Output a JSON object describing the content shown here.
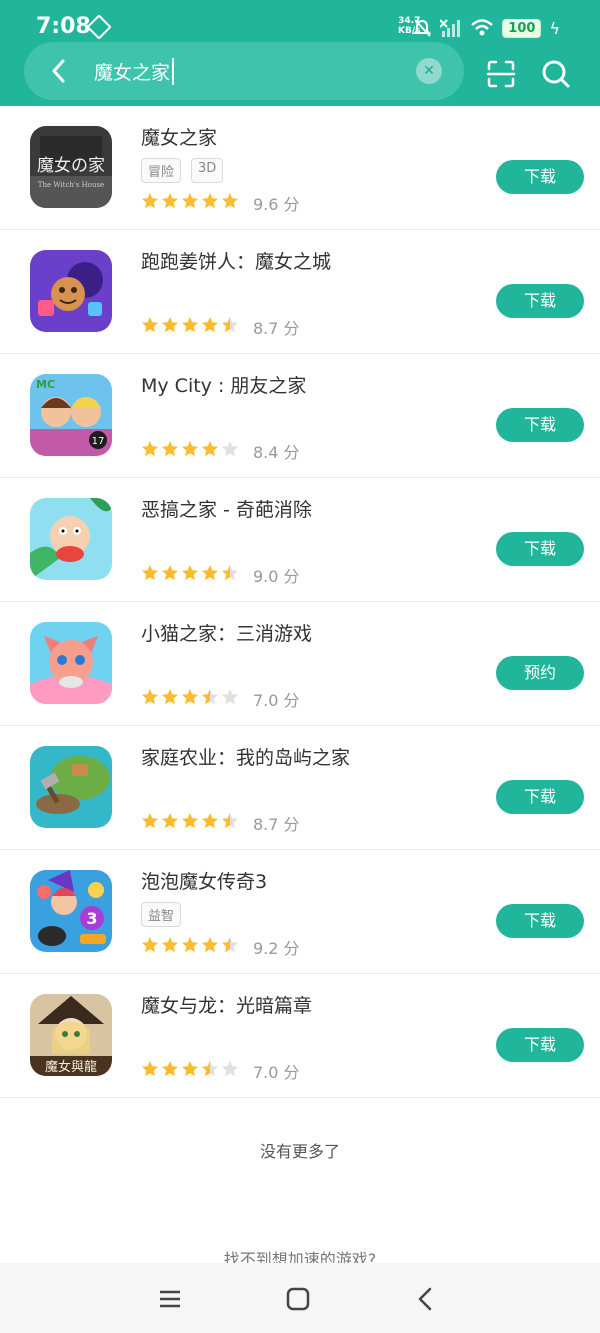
{
  "status_bar": {
    "time": "7:08",
    "net_speed_value": "34.7",
    "net_speed_unit": "KB/s",
    "battery": "100"
  },
  "search": {
    "query": "魔女之家"
  },
  "colors": {
    "accent": "#21b59c",
    "star": "#fdbb2d",
    "star_empty": "#e0e0e0"
  },
  "apps": [
    {
      "name": "魔女之家",
      "tags": [
        "冒险",
        "3D"
      ],
      "rating": 5.0,
      "score": "9.6 分",
      "button": "下载"
    },
    {
      "name": "跑跑姜饼人：魔女之城",
      "tags": [],
      "rating": 4.5,
      "score": "8.7 分",
      "button": "下载"
    },
    {
      "name": "My City : 朋友之家",
      "tags": [],
      "rating": 4.0,
      "score": "8.4 分",
      "button": "下载"
    },
    {
      "name": "恶搞之家 - 奇葩消除",
      "tags": [],
      "rating": 4.5,
      "score": "9.0 分",
      "button": "下载"
    },
    {
      "name": "小猫之家：三消游戏",
      "tags": [],
      "rating": 3.5,
      "score": "7.0 分",
      "button": "预约"
    },
    {
      "name": "家庭农业：我的岛屿之家",
      "tags": [],
      "rating": 4.5,
      "score": "8.7 分",
      "button": "下载"
    },
    {
      "name": "泡泡魔女传奇3",
      "tags": [
        "益智"
      ],
      "rating": 4.5,
      "score": "9.2 分",
      "button": "下载"
    },
    {
      "name": "魔女与龙：光暗篇章",
      "tags": [],
      "rating": 3.5,
      "score": "7.0 分",
      "button": "下载"
    }
  ],
  "footer": {
    "no_more": "没有更多了",
    "cant_find": "找不到想加速的游戏?"
  }
}
